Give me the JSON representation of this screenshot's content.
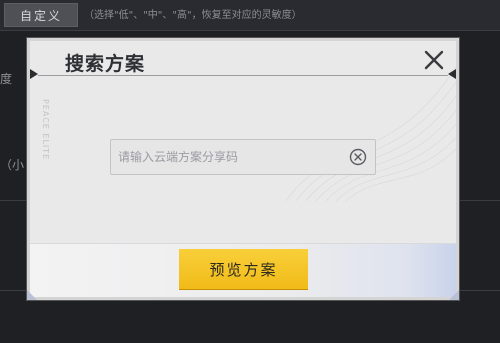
{
  "background": {
    "custom_button_label": "自定义",
    "hint_text": "（选择\"低\"、\"中\"、\"高\"，恢复至对应的灵敏度）",
    "fragment_1": "度",
    "fragment_2": "（小"
  },
  "modal": {
    "title": "搜索方案",
    "side_watermark": "PEACE ELITE",
    "close_icon": "close-icon",
    "search": {
      "placeholder": "请输入云端方案分享码",
      "value": "",
      "clear_icon": "clear-circle-icon"
    },
    "preview_button_label": "预览方案"
  },
  "colors": {
    "accent_yellow": "#f4c22a",
    "title_text": "#2f3034",
    "modal_bg": "#e9e9ea",
    "overlay_bg": "#1f2024"
  }
}
